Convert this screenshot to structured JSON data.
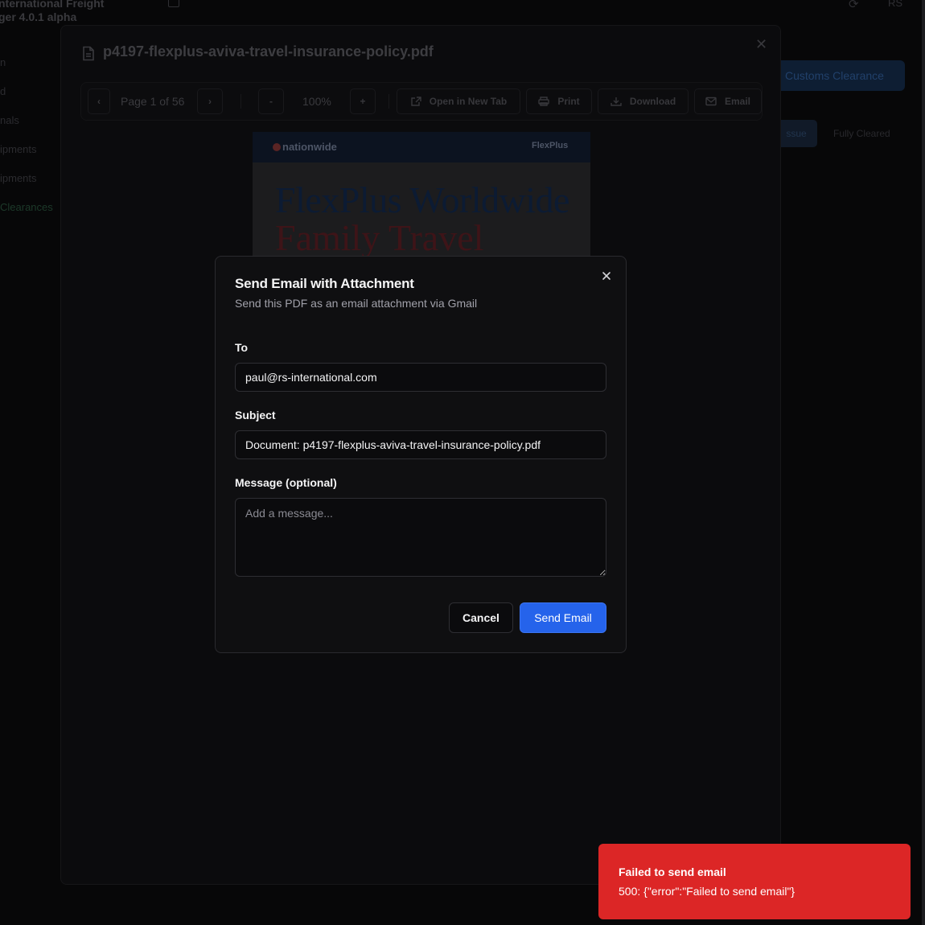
{
  "app": {
    "title": "nternational Freight",
    "version": "ger 4.0.1 alpha",
    "user_initials": "RS",
    "nav_items": [
      "n",
      "d",
      "nals",
      "ipments",
      "ipments",
      "Clearances"
    ],
    "customs_button": "Customs Clearance",
    "status_tabs": [
      "ssue",
      "Fully Cleared"
    ]
  },
  "viewer": {
    "file_name": "p4197-flexplus-aviva-travel-insurance-policy.pdf",
    "page_indicator": "Page 1 of 56",
    "zoom_out": "-",
    "zoom_level": "100%",
    "zoom_in": "+",
    "actions": {
      "open_new_tab": "Open in New Tab",
      "print": "Print",
      "download": "Download",
      "email": "Email"
    },
    "pdf": {
      "brand": "nationwide",
      "product": "FlexPlus",
      "heading": "FlexPlus Worldwide",
      "heading_line2": "Family Travel"
    }
  },
  "email_dialog": {
    "title": "Send Email with Attachment",
    "subtitle": "Send this PDF as an email attachment via Gmail",
    "to_label": "To",
    "to_value": "paul@rs-international.com",
    "subject_label": "Subject",
    "subject_value": "Document: p4197-flexplus-aviva-travel-insurance-policy.pdf",
    "message_label": "Message (optional)",
    "message_placeholder": "Add a message...",
    "message_value": "",
    "cancel_label": "Cancel",
    "send_label": "Send Email"
  },
  "toast": {
    "title": "Failed to send email",
    "description": "500: {\"error\":\"Failed to send email\"}",
    "color": "#dc2626"
  },
  "colors": {
    "primary": "#2563eb",
    "destructive": "#dc2626",
    "background": "#070708"
  }
}
